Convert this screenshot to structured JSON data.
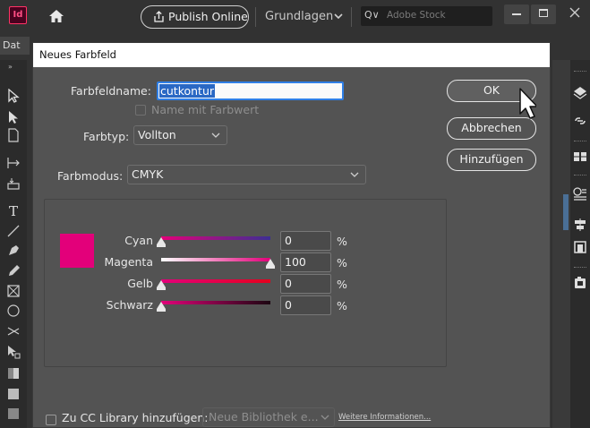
{
  "app": {
    "logo": "Id",
    "publish_label": "Publish Online",
    "workspace_label": "Grundlagen",
    "stock_prefix": "Q∨",
    "stock_placeholder": "Adobe Stock",
    "doc_tab": "Dat"
  },
  "dialog": {
    "title": "Neues Farbfeld",
    "name_label": "Farbfeldname:",
    "name_value": "cutkontur",
    "name_with_value_label": "Name mit Farbwert",
    "type_label": "Farbtyp:",
    "type_value": "Vollton",
    "mode_label": "Farbmodus:",
    "mode_value": "CMYK",
    "buttons": {
      "ok": "OK",
      "cancel": "Abbrechen",
      "add": "Hinzufügen"
    },
    "swatch_color": "#e3007a",
    "channels": [
      {
        "name": "Cyan",
        "value": "0",
        "unit": "%",
        "level": 0
      },
      {
        "name": "Magenta",
        "value": "100",
        "unit": "%",
        "level": 1
      },
      {
        "name": "Gelb",
        "value": "0",
        "unit": "%",
        "level": 0
      },
      {
        "name": "Schwarz",
        "value": "0",
        "unit": "%",
        "level": 0
      }
    ],
    "cc_label": "Zu CC Library hinzufügen:",
    "library_value": "Neue Bibliothek e...",
    "more_info": "Weitere Informationen..."
  },
  "colors": {
    "accent_blue": "#2f7fe6",
    "app_bg": "#323232",
    "dialog_bg": "#535353",
    "magenta": "#e3007a"
  },
  "icons": {
    "home": "home-icon",
    "publish": "share-icon",
    "close": "close-icon"
  }
}
